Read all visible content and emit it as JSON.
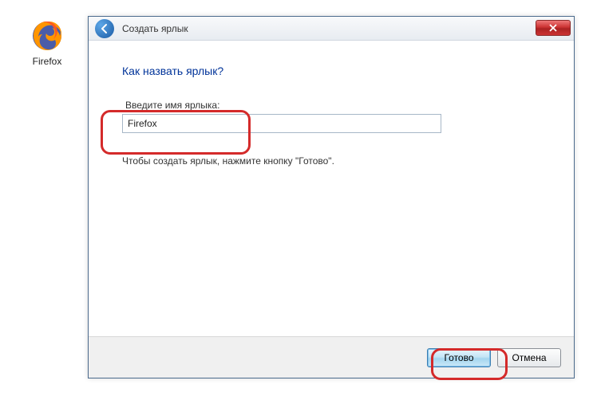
{
  "desktop": {
    "firefox_label": "Firefox"
  },
  "wizard": {
    "title": "Создать ярлык",
    "heading": "Как назвать ярлык?",
    "field_label": "Введите имя ярлыка:",
    "input_value": "Firefox",
    "hint": "Чтобы создать ярлык, нажмите кнопку \"Готово\".",
    "buttons": {
      "finish": "Готово",
      "cancel": "Отмена"
    }
  }
}
